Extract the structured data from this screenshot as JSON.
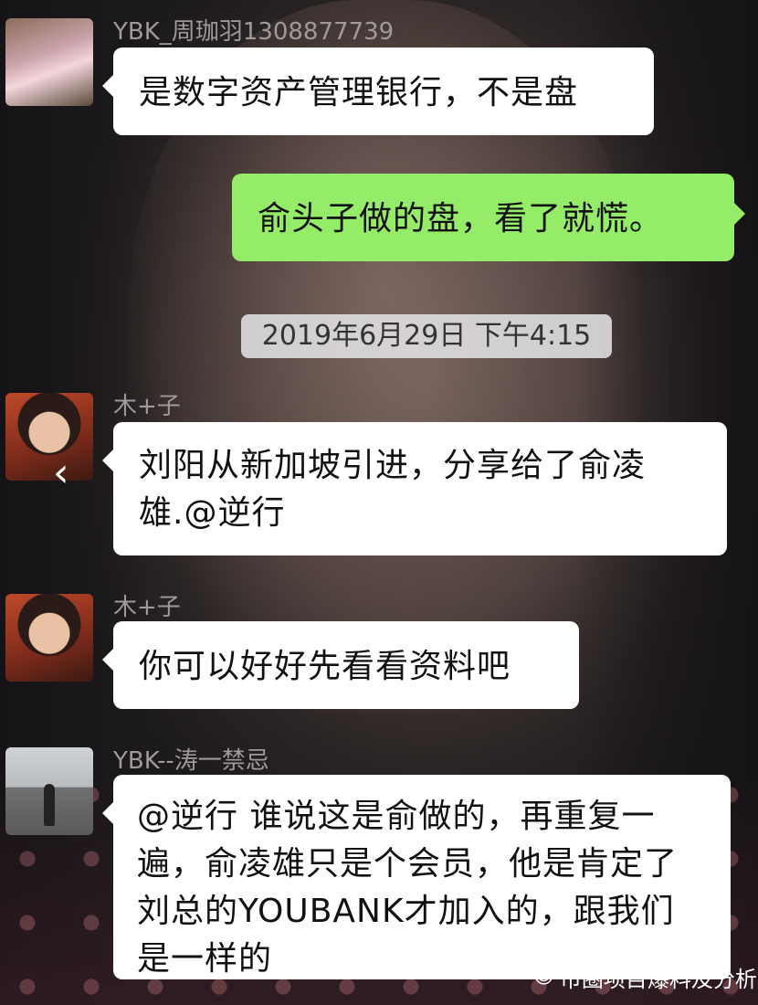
{
  "messages": [
    {
      "sender": "YBK_周珈羽1308877739",
      "text": "是数字资产管理银行，不是盘"
    },
    {
      "text": "俞头子做的盘，看了就慌。"
    },
    {
      "sender": "木+子",
      "text": "刘阳从新加坡引进，分享给了俞凌雄.@逆行"
    },
    {
      "sender": "木+子",
      "text": "你可以好好先看看资料吧"
    },
    {
      "sender": "YBK--涛一禁忌",
      "text": "@逆行 谁说这是俞做的，再重复一遍，俞凌雄只是个会员，他是肯定了刘总的YOUBANK才加入的，跟我们是一样的"
    }
  ],
  "timestamp": "2019年6月29日 下午4:15",
  "watermark": "币圈项目爆料及分析",
  "icons": {
    "back": "chevron-left-icon",
    "watermark": "wechat-icon"
  },
  "colors": {
    "bubble_incoming": "#ffffff",
    "bubble_outgoing": "#95ec69",
    "timestamp_bg": "#e1e1e1"
  }
}
